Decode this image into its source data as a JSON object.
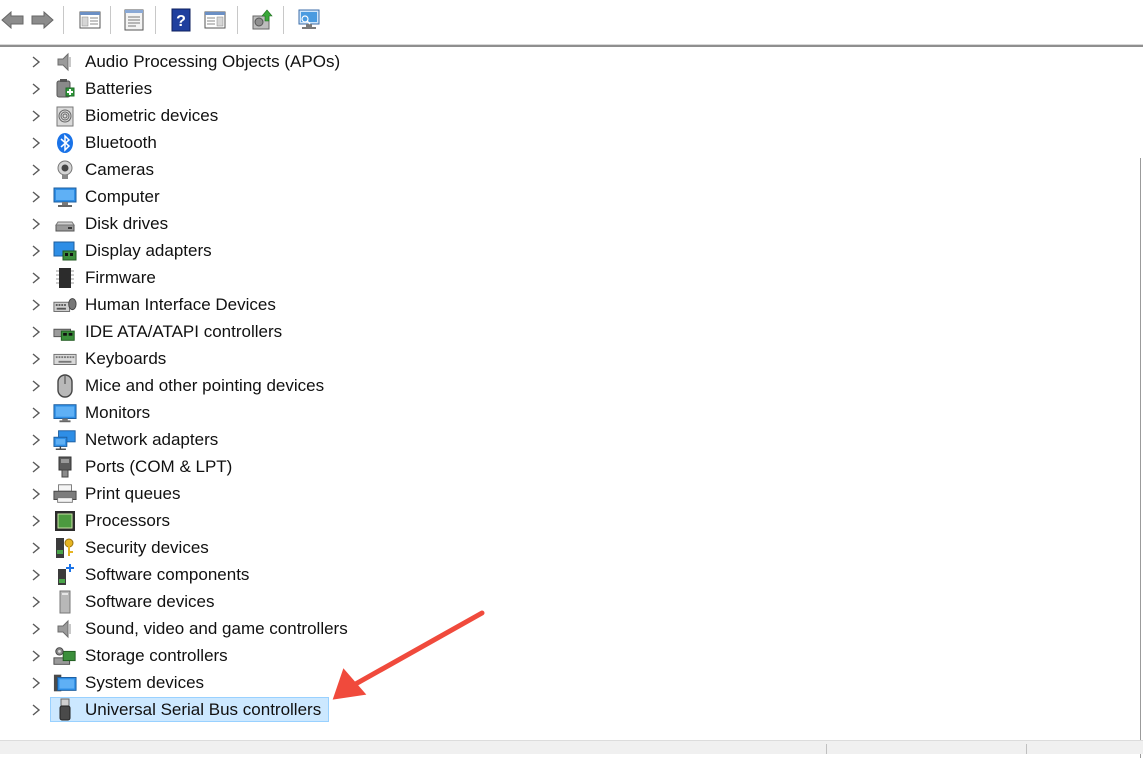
{
  "toolbar": {
    "buttons": [
      {
        "name": "back-arrow-icon"
      },
      {
        "name": "forward-arrow-icon"
      },
      {
        "name": "show-hide-console-tree-icon"
      },
      {
        "name": "properties-icon"
      },
      {
        "name": "help-icon"
      },
      {
        "name": "action-pane-icon"
      },
      {
        "name": "update-driver-icon"
      },
      {
        "name": "scan-hardware-changes-icon"
      }
    ]
  },
  "tree": {
    "items": [
      {
        "label": "Audio Processing Objects (APOs)",
        "icon": "speaker-icon"
      },
      {
        "label": "Batteries",
        "icon": "battery-icon"
      },
      {
        "label": "Biometric devices",
        "icon": "fingerprint-icon"
      },
      {
        "label": "Bluetooth",
        "icon": "bluetooth-icon"
      },
      {
        "label": "Cameras",
        "icon": "webcam-icon"
      },
      {
        "label": "Computer",
        "icon": "computer-icon"
      },
      {
        "label": "Disk drives",
        "icon": "disk-drive-icon"
      },
      {
        "label": "Display adapters",
        "icon": "display-adapter-icon"
      },
      {
        "label": "Firmware",
        "icon": "firmware-chip-icon"
      },
      {
        "label": "Human Interface Devices",
        "icon": "hid-icon"
      },
      {
        "label": "IDE ATA/ATAPI controllers",
        "icon": "ide-controller-icon"
      },
      {
        "label": "Keyboards",
        "icon": "keyboard-icon"
      },
      {
        "label": "Mice and other pointing devices",
        "icon": "mouse-icon"
      },
      {
        "label": "Monitors",
        "icon": "monitor-icon"
      },
      {
        "label": "Network adapters",
        "icon": "network-adapter-icon"
      },
      {
        "label": "Ports (COM & LPT)",
        "icon": "port-icon"
      },
      {
        "label": "Print queues",
        "icon": "printer-icon"
      },
      {
        "label": "Processors",
        "icon": "processor-icon"
      },
      {
        "label": "Security devices",
        "icon": "security-key-icon"
      },
      {
        "label": "Software components",
        "icon": "software-component-icon"
      },
      {
        "label": "Software devices",
        "icon": "software-device-icon"
      },
      {
        "label": "Sound, video and game controllers",
        "icon": "speaker-icon"
      },
      {
        "label": "Storage controllers",
        "icon": "storage-controller-icon"
      },
      {
        "label": "System devices",
        "icon": "system-devices-icon"
      },
      {
        "label": "Universal Serial Bus controllers",
        "icon": "usb-icon",
        "selected": true
      }
    ]
  },
  "colors": {
    "selection_fill": "#cce8ff",
    "selection_border": "#99d1ff",
    "annotation_arrow": "#f04a3c"
  }
}
